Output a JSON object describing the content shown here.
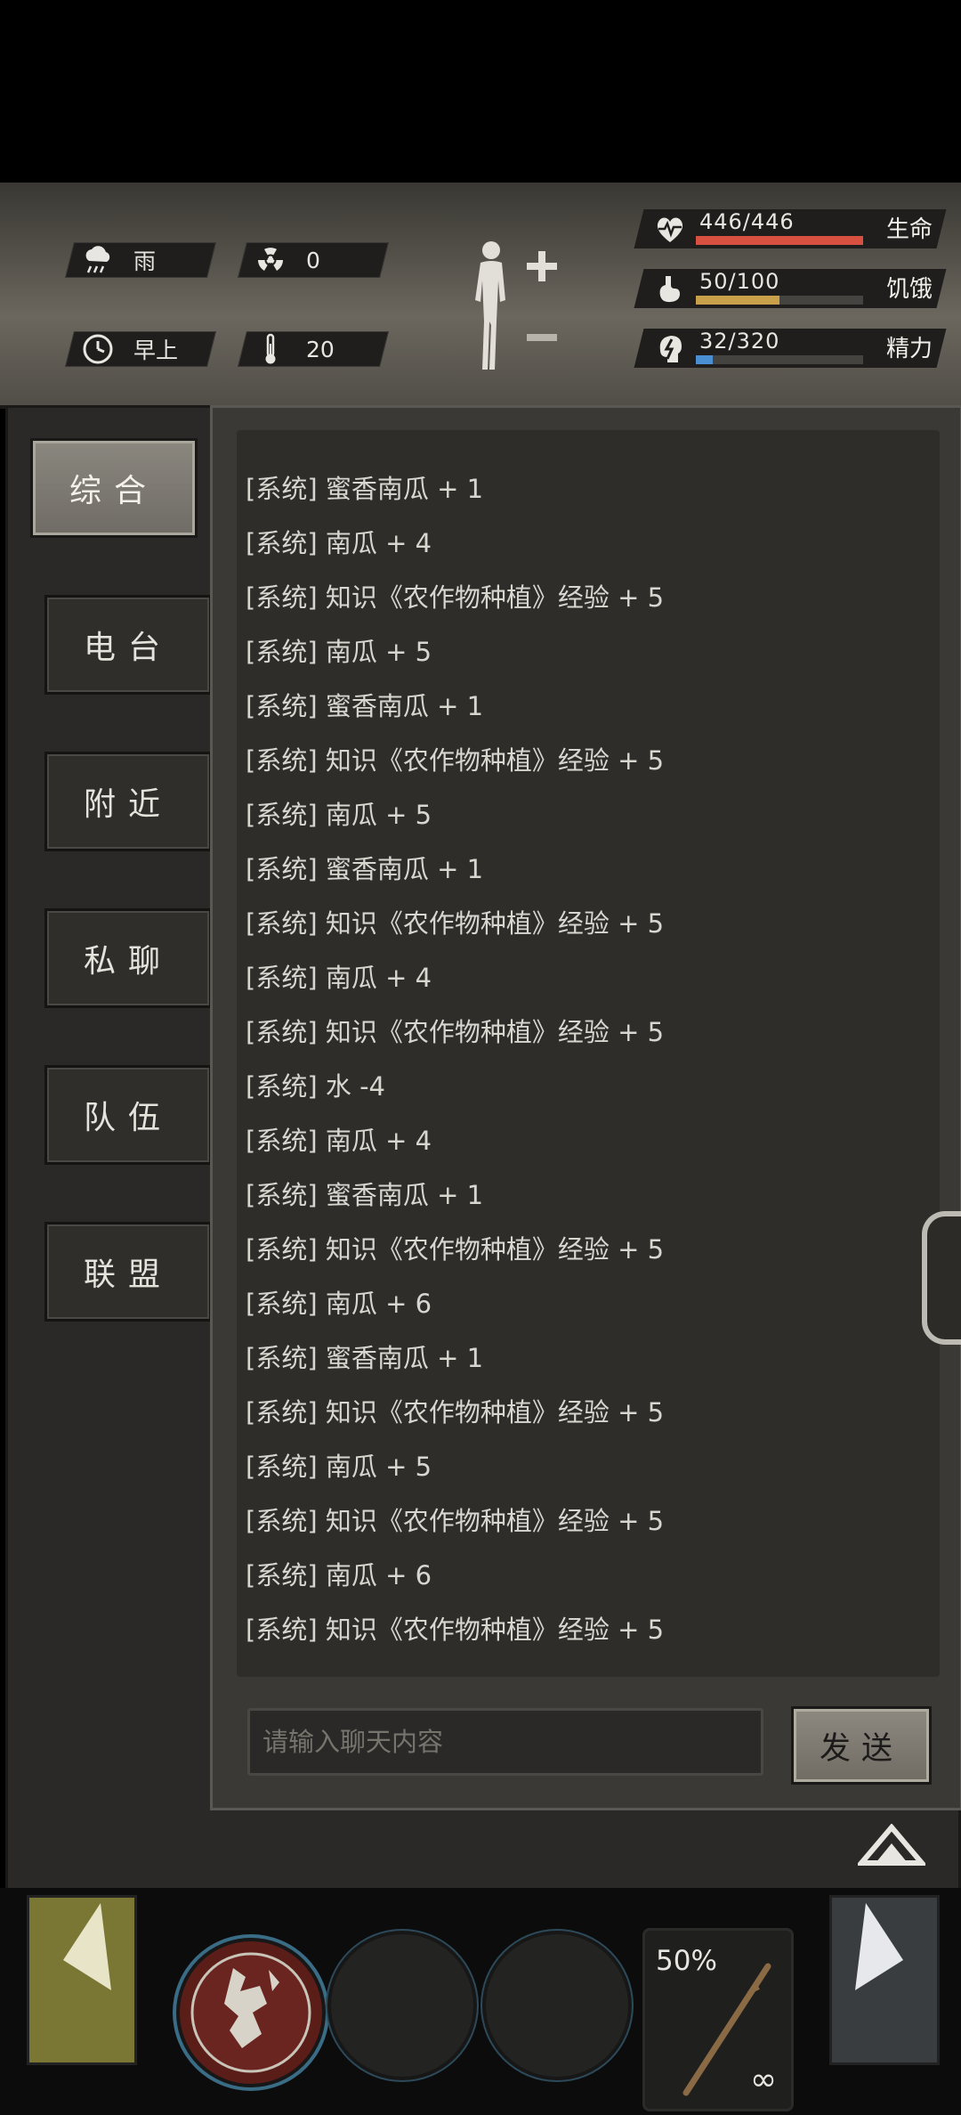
{
  "hud": {
    "weather": {
      "icon": "rain-cloud-icon",
      "label": "雨"
    },
    "radiation": {
      "icon": "radiation-icon",
      "value": "0"
    },
    "time": {
      "icon": "clock-icon",
      "label": "早上"
    },
    "temperature": {
      "icon": "thermometer-icon",
      "value": "20"
    },
    "stats": [
      {
        "key": "health",
        "icon": "heart-pulse-icon",
        "text": "446/446",
        "label": "生命",
        "fraction": 1.0,
        "color": "#d8503f"
      },
      {
        "key": "hunger",
        "icon": "stomach-icon",
        "text": "50/100",
        "label": "饥饿",
        "fraction": 0.5,
        "color": "#c9a04a"
      },
      {
        "key": "energy",
        "icon": "brain-bolt-icon",
        "text": "32/320",
        "label": "精力",
        "fraction": 0.1,
        "color": "#4a8fd1"
      }
    ]
  },
  "tabs": [
    {
      "id": "general",
      "label": "综合",
      "active": true
    },
    {
      "id": "radio",
      "label": "电台",
      "active": false
    },
    {
      "id": "nearby",
      "label": "附近",
      "active": false
    },
    {
      "id": "private",
      "label": "私聊",
      "active": false
    },
    {
      "id": "team",
      "label": "队伍",
      "active": false
    },
    {
      "id": "alliance",
      "label": "联盟",
      "active": false
    }
  ],
  "chat": {
    "lines": [
      "[系统] 蜜香南瓜 + 1",
      "[系统] 南瓜 + 4",
      "[系统] 知识《农作物种植》经验 + 5",
      "[系统] 南瓜 + 5",
      "[系统] 蜜香南瓜 + 1",
      "[系统] 知识《农作物种植》经验 + 5",
      "[系统] 南瓜 + 5",
      "[系统] 蜜香南瓜 + 1",
      "[系统] 知识《农作物种植》经验 + 5",
      "[系统] 南瓜 + 4",
      "[系统] 知识《农作物种植》经验 + 5",
      "[系统] 水 -4",
      "[系统] 南瓜 + 4",
      "[系统] 蜜香南瓜 + 1",
      "[系统] 知识《农作物种植》经验 + 5",
      "[系统] 南瓜 + 6",
      "[系统] 蜜香南瓜 + 1",
      "[系统] 知识《农作物种植》经验 + 5",
      "[系统] 南瓜 + 5",
      "[系统] 知识《农作物种植》经验 + 5",
      "[系统] 南瓜 + 6",
      "[系统] 知识《农作物种植》经验 + 5"
    ],
    "input_placeholder": "请输入聊天内容",
    "send_label": "发送"
  },
  "hotbar": {
    "weapon_durability": "50%",
    "weapon_ammo": "∞"
  }
}
